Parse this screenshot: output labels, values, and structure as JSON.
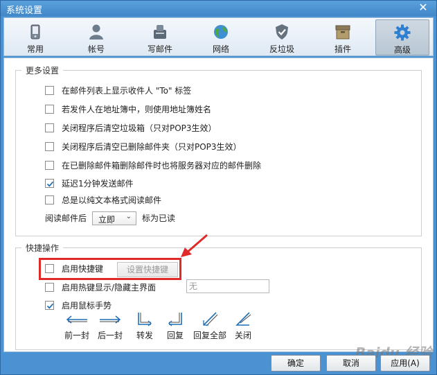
{
  "window": {
    "title": "系统设置"
  },
  "toolbar": {
    "tabs": [
      {
        "label": "常用",
        "icon": "phone-icon"
      },
      {
        "label": "帐号",
        "icon": "user-icon"
      },
      {
        "label": "写邮件",
        "icon": "compose-icon"
      },
      {
        "label": "网络",
        "icon": "globe-icon"
      },
      {
        "label": "反垃圾",
        "icon": "shield-icon"
      },
      {
        "label": "插件",
        "icon": "plugin-box-icon"
      },
      {
        "label": "高级",
        "icon": "gear-icon"
      }
    ],
    "active_index": 6
  },
  "more_settings": {
    "title": "更多设置",
    "options": [
      {
        "label": "在邮件列表上显示收件人 \"To\" 标签",
        "checked": false
      },
      {
        "label": "若发件人在地址簿中，则使用地址簿姓名",
        "checked": false
      },
      {
        "label": "关闭程序后清空垃圾箱（只对POP3生效）",
        "checked": false
      },
      {
        "label": "关闭程序后清空已删除邮件夹（只对POP3生效）",
        "checked": false
      },
      {
        "label": "在已删除邮件箱删除邮件时也将服务器对应的邮件删除",
        "checked": false
      },
      {
        "label": "延迟1分钟发送邮件",
        "checked": true
      },
      {
        "label": "总是以纯文本格式阅读邮件",
        "checked": false
      }
    ],
    "read_prefix": "阅读邮件后",
    "read_select_value": "立即",
    "read_suffix": "标为已读"
  },
  "shortcuts": {
    "title": "快捷操作",
    "enable_hotkey_label": "启用快捷键",
    "enable_hotkey_checked": false,
    "set_hotkey_button": "设置快捷键",
    "hotkey_toggle_label": "启用热键显示/隐藏主界面",
    "hotkey_toggle_checked": false,
    "hotkey_value": "无",
    "mouse_gesture_label": "启用鼠标手势",
    "mouse_gesture_checked": true,
    "gestures": [
      {
        "label": "前一封",
        "icon": "arrow-left-icon"
      },
      {
        "label": "后一封",
        "icon": "arrow-right-icon"
      },
      {
        "label": "转发",
        "icon": "down-right-icon"
      },
      {
        "label": "回复",
        "icon": "down-left-icon"
      },
      {
        "label": "回复全部",
        "icon": "diagonal-left-icon"
      },
      {
        "label": "关闭",
        "icon": "diagonal-close-icon"
      }
    ]
  },
  "footer": {
    "ok": "确定",
    "cancel": "取消",
    "apply": "应用(A)"
  },
  "watermark": "Baidu 经验",
  "colors": {
    "title_bar": "#4a92d1",
    "highlight": "#e02a2a",
    "check": "#1f6fb8"
  }
}
